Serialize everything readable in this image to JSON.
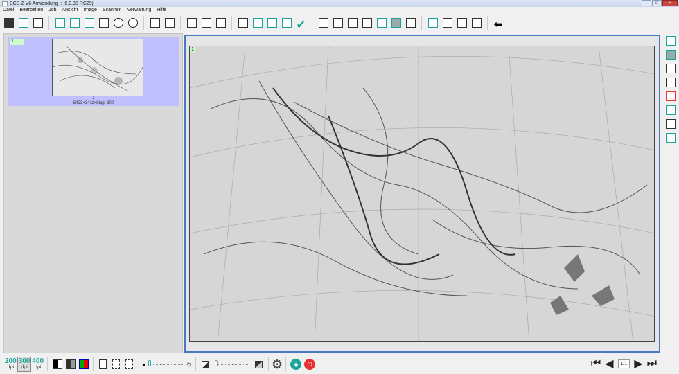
{
  "window": {
    "title": "BCS-2 V6 Anwendung :: [6.0.38 RC29]",
    "min": "–",
    "max": "□",
    "close": "✕"
  },
  "menu": [
    "Datei",
    "Bearbeiten",
    "Job",
    "Ansicht",
    "Image",
    "Scannen",
    "Verwaltung",
    "Hilfe"
  ],
  "toolbar_groups": [
    [
      "save-icon",
      "scan-to-screen-icon",
      "exit-icon"
    ],
    [
      "fit-height-icon",
      "fit-width-icon",
      "fit-page-icon",
      "actual-size-icon",
      "zoom-in-icon",
      "zoom-out-icon"
    ],
    [
      "job-settings-icon",
      "job-next-icon"
    ],
    [
      "clipboard-icon",
      "cut-icon",
      "paste-icon"
    ],
    [
      "crop-corner-icon",
      "split-center-icon",
      "split-left-icon",
      "split-right-icon",
      "confirm-check-icon"
    ],
    [
      "page-flip-icon",
      "rotate-page-icon",
      "upload-image-icon",
      "image-icon",
      "frame-white-icon",
      "frame-gray-icon",
      "edit-image-icon"
    ],
    [
      "add-page-icon",
      "insert-page-icon",
      "replace-page-icon",
      "move-page-icon"
    ],
    [
      "back-arrow-icon"
    ]
  ],
  "right_panel": [
    "frame-white-icon",
    "frame-gray-icon",
    "page-flip-icon",
    "rotate-page-icon",
    "red-corners-icon",
    "split-center-icon",
    "crop-corner-icon",
    "split-both-icon"
  ],
  "thumbnail": {
    "number": "1",
    "label": "1",
    "info": "5423×3411×8bpp 300"
  },
  "page_marker": "1",
  "bottom": {
    "dpi": [
      {
        "value": "200",
        "unit": "dpi"
      },
      {
        "value": "300",
        "unit": "dpi",
        "selected": true
      },
      {
        "value": "400",
        "unit": "dpi"
      }
    ],
    "pager": "1/1",
    "brightness": 0,
    "contrast": 0
  }
}
